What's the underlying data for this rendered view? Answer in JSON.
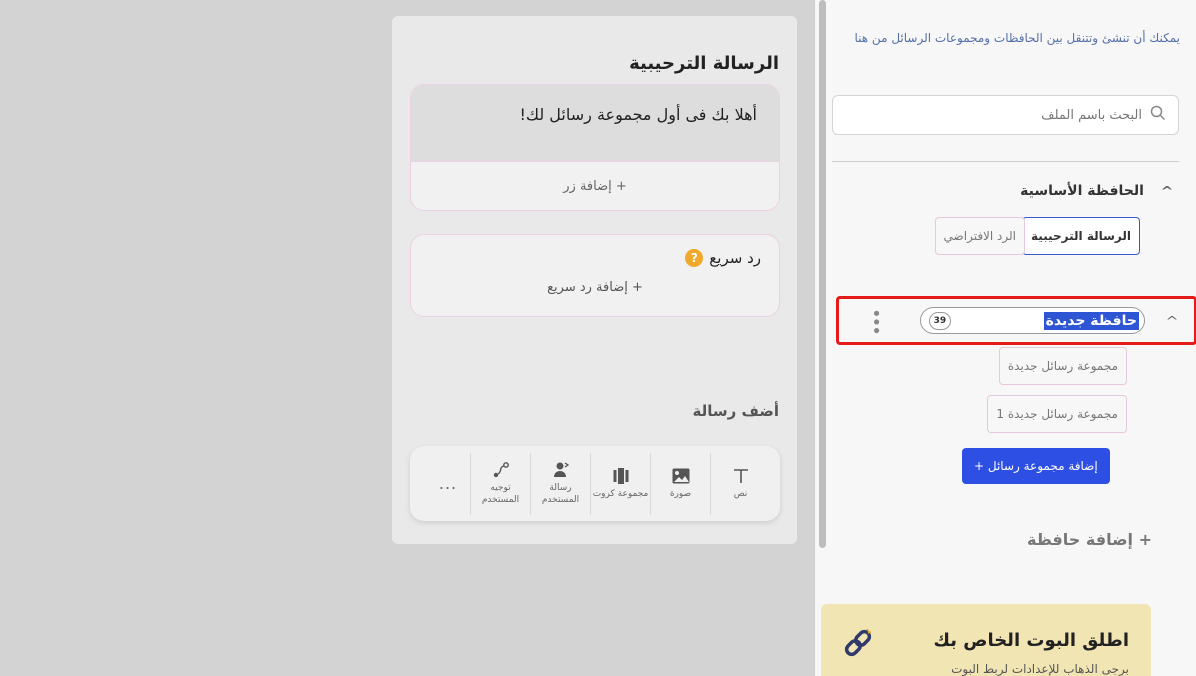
{
  "message_panel": {
    "title": "الرسالة الترحيبية",
    "welcome_text": "أهلا بك فى أول مجموعة رسائل لك!",
    "add_button_label": "+ إضافة زر",
    "quick_reply_title": "رد سريع",
    "add_quick_reply_label": "+ إضافة رد سريع",
    "add_message_title": "أضف رسالة",
    "tools": [
      {
        "label": "نص",
        "icon": "text-icon"
      },
      {
        "label": "صورة",
        "icon": "image-icon"
      },
      {
        "label": "مجموعة كروت",
        "icon": "cards-icon"
      },
      {
        "label": "رسالة المستخدم",
        "icon": "user-message-icon"
      },
      {
        "label": "توجيه المستخدم",
        "icon": "route-icon"
      }
    ],
    "more_label": "..."
  },
  "sidebar": {
    "intro": "يمكنك أن تنشئ وتتنقل بين الحافظات ومجموعات الرسائل من هنا",
    "search_placeholder": "البحث باسم الملف",
    "main_folder": {
      "title": "الحافظة الأساسية",
      "chips": [
        "الرسالة الترحيبية",
        "الرد الافتراضي"
      ]
    },
    "new_folder": {
      "name_value": "حافظة جديدة",
      "char_count": "39",
      "groups": [
        "مجموعة رسائل جديدة",
        "مجموعة رسائل جديدة 1"
      ],
      "add_group_label": "إضافة مجموعة رسائل +"
    },
    "add_folder_label": "+ إضافة حافظة",
    "launch": {
      "title": "اطلق البوت الخاص بك",
      "subtitle": "برجى الذهاب للإعدادات لربط البوت"
    }
  },
  "colors": {
    "accent": "#2d4fe3",
    "highlight_border": "#e51b1b",
    "help": "#f0a92a",
    "launch_bg": "#f2e5b4"
  }
}
